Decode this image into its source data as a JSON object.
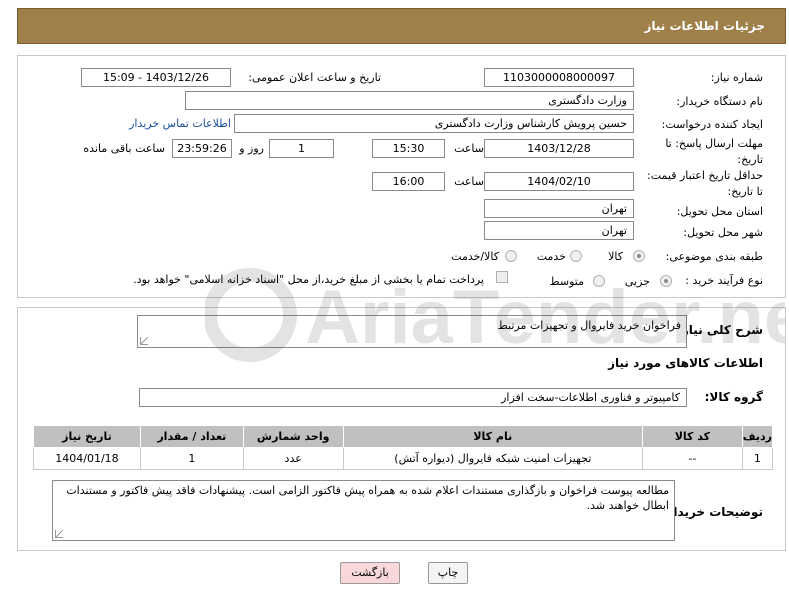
{
  "header": {
    "title": "جزئیات اطلاعات نیاز"
  },
  "form": {
    "need_number": {
      "label": "شماره نیاز:",
      "value": "1103000008000097"
    },
    "announce": {
      "label": "تاریخ و ساعت اعلان عمومی:",
      "value": "1403/12/26 - 15:09"
    },
    "buyer": {
      "label": "نام دستگاه خریدار:",
      "value": "وزارت دادگستری"
    },
    "creator": {
      "label": "ایجاد کننده درخواست:",
      "value": "حسین پرویش کارشناس وزارت دادگستری",
      "contact_link": "اطلاعات تماس خریدار"
    },
    "deadline": {
      "label": "مهلت ارسال پاسخ: تا تاریخ:",
      "date": "1403/12/28",
      "time_label": "ساعت",
      "time": "15:30",
      "days": "1",
      "days_label": "روز و",
      "remaining": "23:59:26",
      "remaining_label": "ساعت باقی مانده"
    },
    "validity": {
      "label": "حداقل تاریخ اعتبار قیمت: تا تاریخ:",
      "date": "1404/02/10",
      "time_label": "ساعت",
      "time": "16:00"
    },
    "province": {
      "label": "استان محل تحویل:",
      "value": "تهران"
    },
    "city": {
      "label": "شهر محل تحویل:",
      "value": "تهران"
    },
    "category": {
      "label": "طبقه بندی موضوعی:",
      "options": [
        "کالا",
        "خدمت",
        "کالا/خدمت"
      ]
    },
    "process": {
      "label": "نوع فرآیند خرید :",
      "options": [
        "جزیی",
        "متوسط"
      ],
      "payment_note": "پرداخت تمام یا بخشی از مبلغ خرید،از محل \"اسناد خزانه اسلامی\" خواهد بود."
    }
  },
  "details": {
    "description_label": "شرح کلی نیاز:",
    "description": "فراخوان خرید فایروال و تجهیزات مرتبط",
    "goods_info_title": "اطلاعات کالاهای مورد نیاز",
    "group_label": "گروه کالا:",
    "group_value": "کامپیوتر و فناوری اطلاعات-سخت افزار",
    "table": {
      "headers": [
        "ردیف",
        "کد کالا",
        "نام کالا",
        "واحد شمارش",
        "تعداد / مقدار",
        "تاریخ نیاز"
      ],
      "rows": [
        [
          "1",
          "--",
          "تجهیزات امنیت شبکه فایروال (دیواره آتش)",
          "عدد",
          "1",
          "1404/01/18"
        ]
      ]
    },
    "buyer_notes_label": "توضیحات خریدار:",
    "buyer_notes": "مطالعه پیوست فراخوان و بازگذاری مستندات اعلام شده به همراه پیش فاکتور الزامی است. پیشنهادات فاقد پیش فاکتور و مستندات ابطال خواهند شد."
  },
  "buttons": {
    "print": "چاپ",
    "back": "بازگشت"
  },
  "watermark": {
    "text": "AriaTender.net"
  }
}
